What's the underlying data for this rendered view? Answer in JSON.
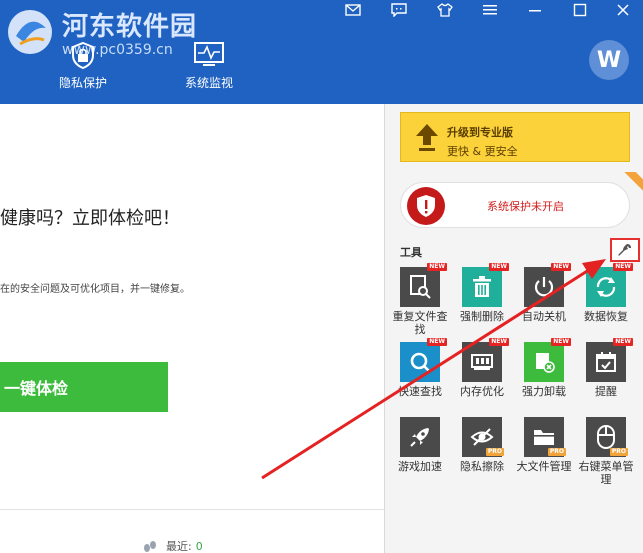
{
  "watermark": {
    "title": "河东软件园",
    "url": "www.pc0359.cn"
  },
  "nav": {
    "items": [
      {
        "label": "隐私保护"
      },
      {
        "label": "系统监视"
      }
    ]
  },
  "user": {
    "avatar_initial": "W"
  },
  "main": {
    "headline": "健康吗？立即体检吧！",
    "subline": "在的安全问题及可优化项目，并一键修复。",
    "check_button": "一键体检",
    "footer_stat_label": "最近:",
    "footer_stat_value": "0"
  },
  "sidebar": {
    "upgrade": {
      "title": "升级到专业版",
      "subtitle": "更快 & 更安全"
    },
    "protection_status": "系统保护未开启",
    "tools_title": "工具",
    "tools": [
      {
        "label": "重复文件查找",
        "icon": "duplicate-file-icon",
        "color": "#4a4a4a",
        "badge": "NEW"
      },
      {
        "label": "强制删除",
        "icon": "trash-icon",
        "color": "#1faf9a",
        "badge": "NEW"
      },
      {
        "label": "自动关机",
        "icon": "power-icon",
        "color": "#4a4a4a",
        "badge": "NEW"
      },
      {
        "label": "数据恢复",
        "icon": "recover-icon",
        "color": "#1faf9a",
        "badge": "NEW"
      },
      {
        "label": "快速查找",
        "icon": "quick-search-icon",
        "color": "#1a8fc9",
        "badge": "NEW"
      },
      {
        "label": "内存优化",
        "icon": "memory-icon",
        "color": "#4a4a4a",
        "badge": "NEW"
      },
      {
        "label": "强力卸载",
        "icon": "uninstall-icon",
        "color": "#3dbb3d",
        "badge": "NEW"
      },
      {
        "label": "提醒",
        "icon": "reminder-icon",
        "color": "#4a4a4a",
        "badge": "NEW"
      },
      {
        "label": "游戏加速",
        "icon": "rocket-icon",
        "color": "#4a4a4a",
        "badge": ""
      },
      {
        "label": "隐私擦除",
        "icon": "privacy-erase-icon",
        "color": "#4a4a4a",
        "badge": "PRO"
      },
      {
        "label": "大文件管理",
        "icon": "large-file-icon",
        "color": "#4a4a4a",
        "badge": "PRO"
      },
      {
        "label": "右键菜单管理",
        "icon": "mouse-icon",
        "color": "#4a4a4a",
        "badge": "PRO"
      }
    ]
  },
  "colors": {
    "header": "#1f62c2",
    "accent_green": "#3dbb3d",
    "alert_red": "#e53030",
    "upgrade_yellow": "#fbd23a"
  }
}
